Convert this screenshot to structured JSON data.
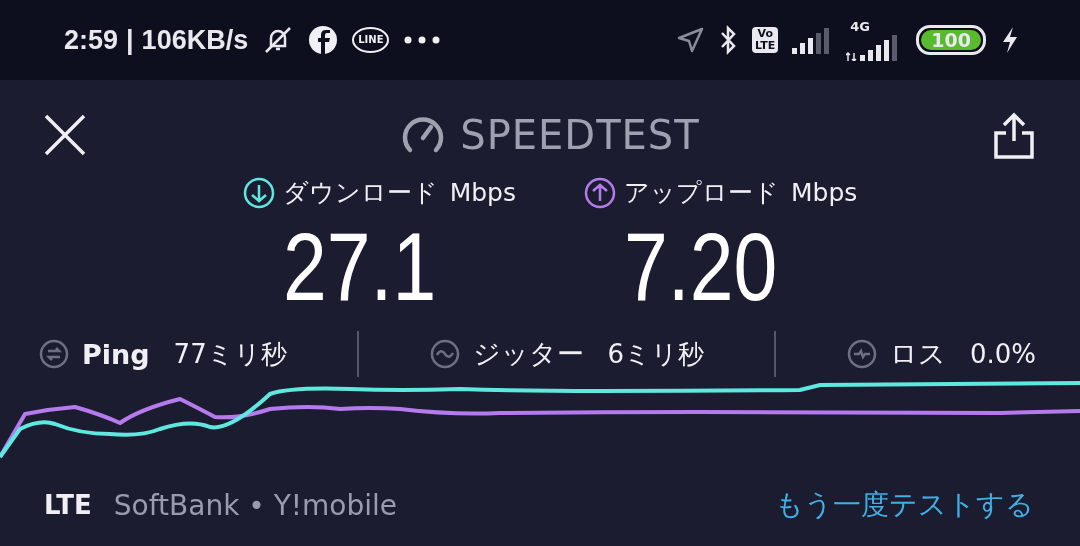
{
  "status_bar": {
    "time": "2:59",
    "separator": "|",
    "speed": "106KB/s",
    "line_icon_text": "LINE",
    "volte": [
      "Vo",
      "LTE"
    ],
    "network": "4G",
    "battery": "100"
  },
  "header": {
    "title": "SPEEDTEST"
  },
  "results": [
    {
      "kind": "download",
      "label": "ダウンロード",
      "unit": "Mbps",
      "value": "27.1",
      "color": "#5ee8e0"
    },
    {
      "kind": "upload",
      "label": "アップロード",
      "unit": "Mbps",
      "value": "7.20",
      "color": "#b57bee"
    }
  ],
  "stats": [
    {
      "kind": "ping",
      "label": "Ping",
      "value": "77ミリ秒"
    },
    {
      "kind": "jitter",
      "label": "ジッター",
      "value": "6ミリ秒"
    },
    {
      "kind": "loss",
      "label": "ロス",
      "value": "0.0%"
    }
  ],
  "footer": {
    "connection": "LTE",
    "provider": "SoftBank • Y!mobile",
    "retest": "もう一度テストする"
  }
}
